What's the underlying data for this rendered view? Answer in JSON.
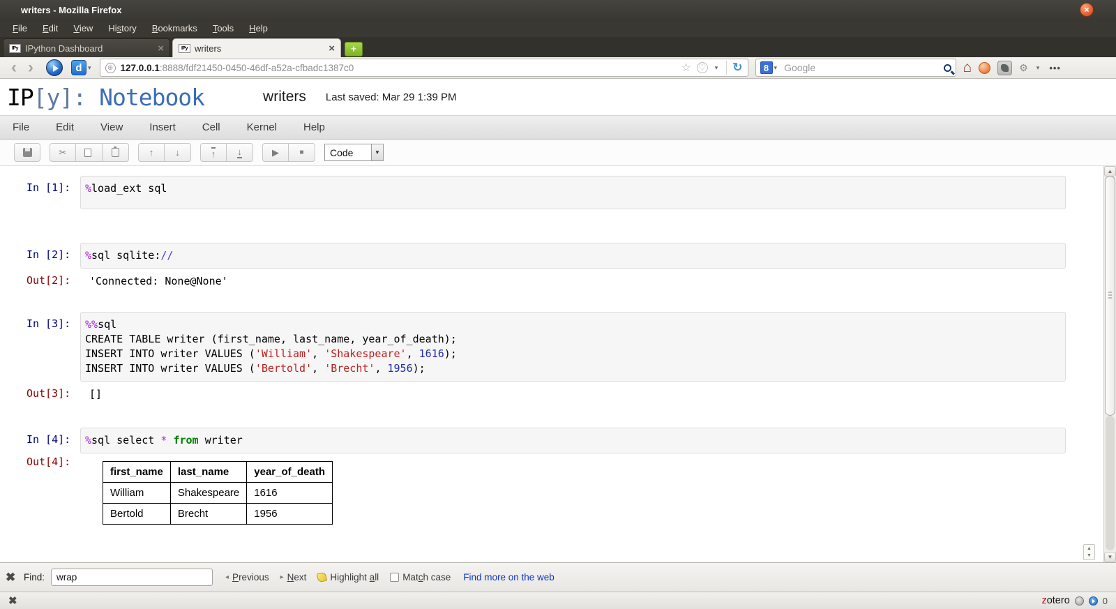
{
  "window": {
    "title": "writers - Mozilla Firefox",
    "close_glyph": "×"
  },
  "browser_menu": {
    "items": [
      {
        "pre": "",
        "accel": "F",
        "post": "ile"
      },
      {
        "pre": "",
        "accel": "E",
        "post": "dit"
      },
      {
        "pre": "",
        "accel": "V",
        "post": "iew"
      },
      {
        "pre": "Hi",
        "accel": "s",
        "post": "tory"
      },
      {
        "pre": "",
        "accel": "B",
        "post": "ookmarks"
      },
      {
        "pre": "",
        "accel": "T",
        "post": "ools"
      },
      {
        "pre": "",
        "accel": "H",
        "post": "elp"
      }
    ]
  },
  "tabs": {
    "inactive": {
      "favicon": "IPy",
      "title": "IPython Dashboard",
      "close": "×"
    },
    "active": {
      "favicon": "IPy",
      "title": "writers",
      "close": "×"
    },
    "new_tab_label": "+"
  },
  "navbar": {
    "url_host": "127.0.0.1",
    "url_rest": ":8888/fdf21450-0450-46df-a52a-cfbadc1387c0",
    "search_engine_glyph": "8",
    "search_placeholder": "Google"
  },
  "notebook": {
    "logo": {
      "ip": "IP",
      "y": "[y]:",
      "name": " Notebook"
    },
    "title": "writers",
    "last_saved": "Last saved: Mar 29 1:39 PM",
    "menu": [
      "File",
      "Edit",
      "View",
      "Insert",
      "Cell",
      "Kernel",
      "Help"
    ],
    "toolbar": {
      "celltype_value": "Code"
    }
  },
  "cells": [
    {
      "kind": "code",
      "prompt": "In [1]:",
      "lines": [
        [
          [
            "mag",
            "%"
          ],
          [
            "",
            "load_ext sql"
          ]
        ]
      ]
    },
    {
      "kind": "code",
      "prompt": "In [2]:",
      "lines": [
        [
          [
            "mag",
            "%"
          ],
          [
            "",
            "sql sqlite:"
          ],
          [
            "op",
            "//"
          ]
        ]
      ]
    },
    {
      "kind": "out",
      "prompt": "Out[2]:",
      "text": "'Connected: None@None'"
    },
    {
      "kind": "code",
      "prompt": "In [3]:",
      "lines": [
        [
          [
            "mag",
            "%%"
          ],
          [
            "",
            "sql"
          ]
        ],
        [
          [
            "",
            "CREATE TABLE writer (first_name, last_name, year_of_death);"
          ]
        ],
        [
          [
            "",
            "INSERT INTO writer VALUES ("
          ],
          [
            "str",
            "'William'"
          ],
          [
            "",
            ", "
          ],
          [
            "str",
            "'Shakespeare'"
          ],
          [
            "",
            ", "
          ],
          [
            "num",
            "1616"
          ],
          [
            "",
            ");"
          ]
        ],
        [
          [
            "",
            "INSERT INTO writer VALUES ("
          ],
          [
            "str",
            "'Bertold'"
          ],
          [
            "",
            ", "
          ],
          [
            "str",
            "'Brecht'"
          ],
          [
            "",
            ", "
          ],
          [
            "num",
            "1956"
          ],
          [
            "",
            ");"
          ]
        ]
      ]
    },
    {
      "kind": "out",
      "prompt": "Out[3]:",
      "text": "[]"
    },
    {
      "kind": "code",
      "prompt": "In [4]:",
      "lines": [
        [
          [
            "mag",
            "%"
          ],
          [
            "",
            "sql select "
          ],
          [
            "mag",
            "*"
          ],
          [
            "",
            " "
          ],
          [
            "kw",
            "from"
          ],
          [
            "",
            " writer"
          ]
        ]
      ]
    },
    {
      "kind": "table",
      "prompt": "Out[4]:",
      "headers": [
        "first_name",
        "last_name",
        "year_of_death"
      ],
      "rows": [
        [
          "William",
          "Shakespeare",
          "1616"
        ],
        [
          "Bertold",
          "Brecht",
          "1956"
        ]
      ]
    }
  ],
  "findbar": {
    "label": "Find:",
    "value": "wrap",
    "previous": {
      "pre": "",
      "accel": "P",
      "post": "revious"
    },
    "next": {
      "pre": "",
      "accel": "N",
      "post": "ext"
    },
    "highlight": {
      "pre": "Highlight ",
      "accel": "a",
      "post": "ll"
    },
    "matchcase": {
      "pre": "Mat",
      "accel": "c",
      "post": "h case"
    },
    "web_link": "Find more on the web"
  },
  "addonbar": {
    "zotero_z": "z",
    "zotero_rest": "otero",
    "count": "0"
  },
  "colors": {
    "in_prompt": "#000080",
    "out_prompt": "#8B0000",
    "magic": "#B122DD",
    "string": "#BA2121",
    "number": "#1F2DA8",
    "keyword": "#008000",
    "operator": "#4A3FD0",
    "accent_orange": "#E8663A",
    "link_blue": "#0B36CC"
  }
}
